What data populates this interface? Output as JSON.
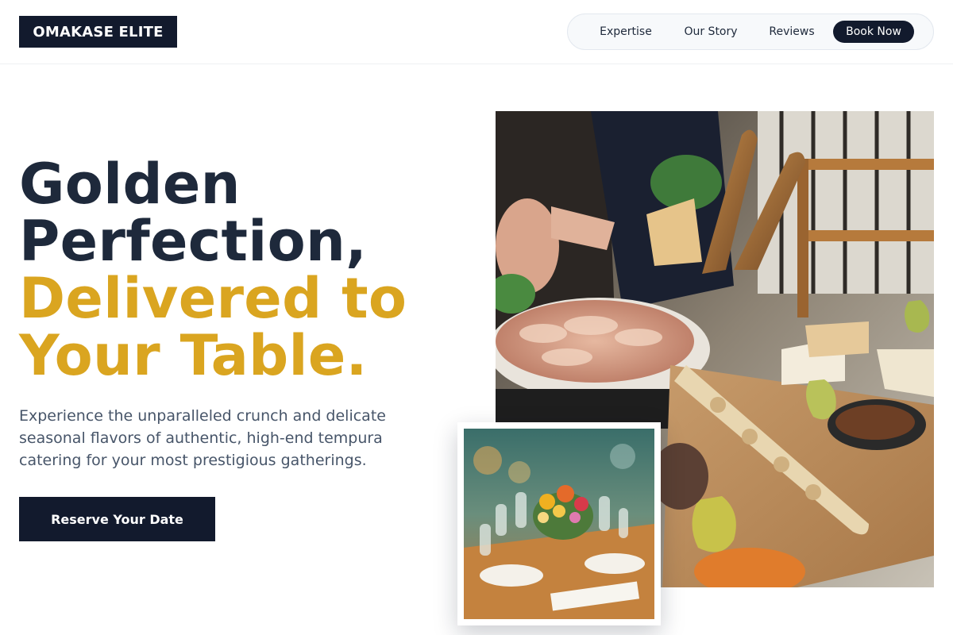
{
  "brand": {
    "logo_text": "OMAKASE ELITE"
  },
  "nav": {
    "items": [
      {
        "label": "Expertise"
      },
      {
        "label": "Our Story"
      },
      {
        "label": "Reviews"
      }
    ],
    "book_label": "Book Now"
  },
  "hero": {
    "title_line1": "Golden",
    "title_line2": "Perfection,",
    "title_line3": "Delivered to",
    "title_line4": "Your Table.",
    "description": "Experience the unparalleled crunch and delicate seasonal flavors of authentic, high-end tempura catering for your most prestigious gatherings.",
    "cta_label": "Reserve Your Date"
  },
  "colors": {
    "navy": "#121a2d",
    "gold": "#daa520",
    "slate_text": "#475569"
  }
}
